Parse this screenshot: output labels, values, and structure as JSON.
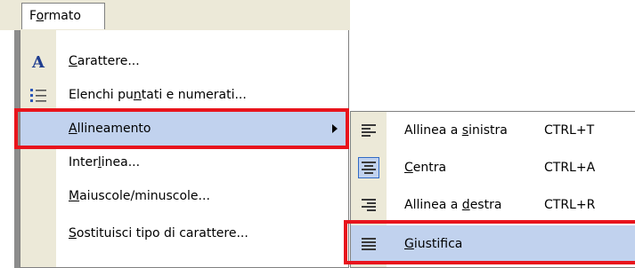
{
  "menubar": {
    "title": "Formato",
    "title_underline": "o",
    "title_pre": "F",
    "title_post": "rmato"
  },
  "menu": {
    "items": [
      {
        "pre": "",
        "ul": "C",
        "post": "arattere...",
        "icon": "font-A-icon"
      },
      {
        "pre": "Elenchi pu",
        "ul": "n",
        "post": "tati e numerati...",
        "icon": "bullets-numbering-icon"
      },
      {
        "pre": "",
        "ul": "A",
        "post": "llineamento",
        "icon": "",
        "has_submenu": true
      },
      {
        "pre": "Inter",
        "ul": "l",
        "post": "inea...",
        "icon": ""
      },
      {
        "pre": "",
        "ul": "M",
        "post": "aiuscole/minuscole...",
        "icon": ""
      },
      {
        "pre": "",
        "ul": "S",
        "post": "ostituisci tipo di carattere...",
        "icon": ""
      }
    ]
  },
  "submenu": {
    "items": [
      {
        "pre": "Allinea a ",
        "ul": "s",
        "post": "inistra",
        "shortcut": "CTRL+T",
        "icon": "align-left-icon"
      },
      {
        "pre": "",
        "ul": "C",
        "post": "entra",
        "shortcut": "CTRL+A",
        "icon": "align-center-icon"
      },
      {
        "pre": "Allinea a ",
        "ul": "d",
        "post": "estra",
        "shortcut": "CTRL+R",
        "icon": "align-right-icon"
      },
      {
        "pre": "",
        "ul": "G",
        "post": "iustifica",
        "shortcut": "",
        "icon": "justify-icon"
      }
    ]
  },
  "colors": {
    "highlight": "#c1d2ee",
    "gutter": "#ece9d8",
    "callout_red": "#e8141c"
  }
}
